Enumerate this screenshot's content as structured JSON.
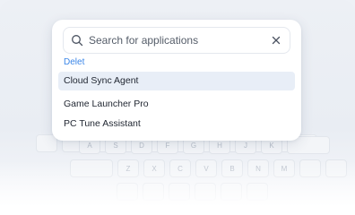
{
  "search": {
    "placeholder": "Search for applications",
    "value": ""
  },
  "query_label": "Delet",
  "results": [
    {
      "label": "Cloud Sync Agent",
      "selected": true
    },
    {
      "label": "Game Launcher Pro",
      "selected": false
    },
    {
      "label": "PC Tune Assistant",
      "selected": false
    }
  ],
  "keyboard": {
    "row1": [
      "",
      "",
      "",
      "",
      "",
      "",
      "",
      "",
      "",
      "",
      ""
    ],
    "row2": [
      "A",
      "S",
      "D",
      "F",
      "G",
      "H",
      "J",
      "K",
      ""
    ],
    "row3": [
      "",
      "Z",
      "X",
      "C",
      "V",
      "B",
      "N",
      "M",
      "",
      ""
    ]
  },
  "colors": {
    "accent": "#3a86e8",
    "selected_bg": "#e8eef7"
  }
}
